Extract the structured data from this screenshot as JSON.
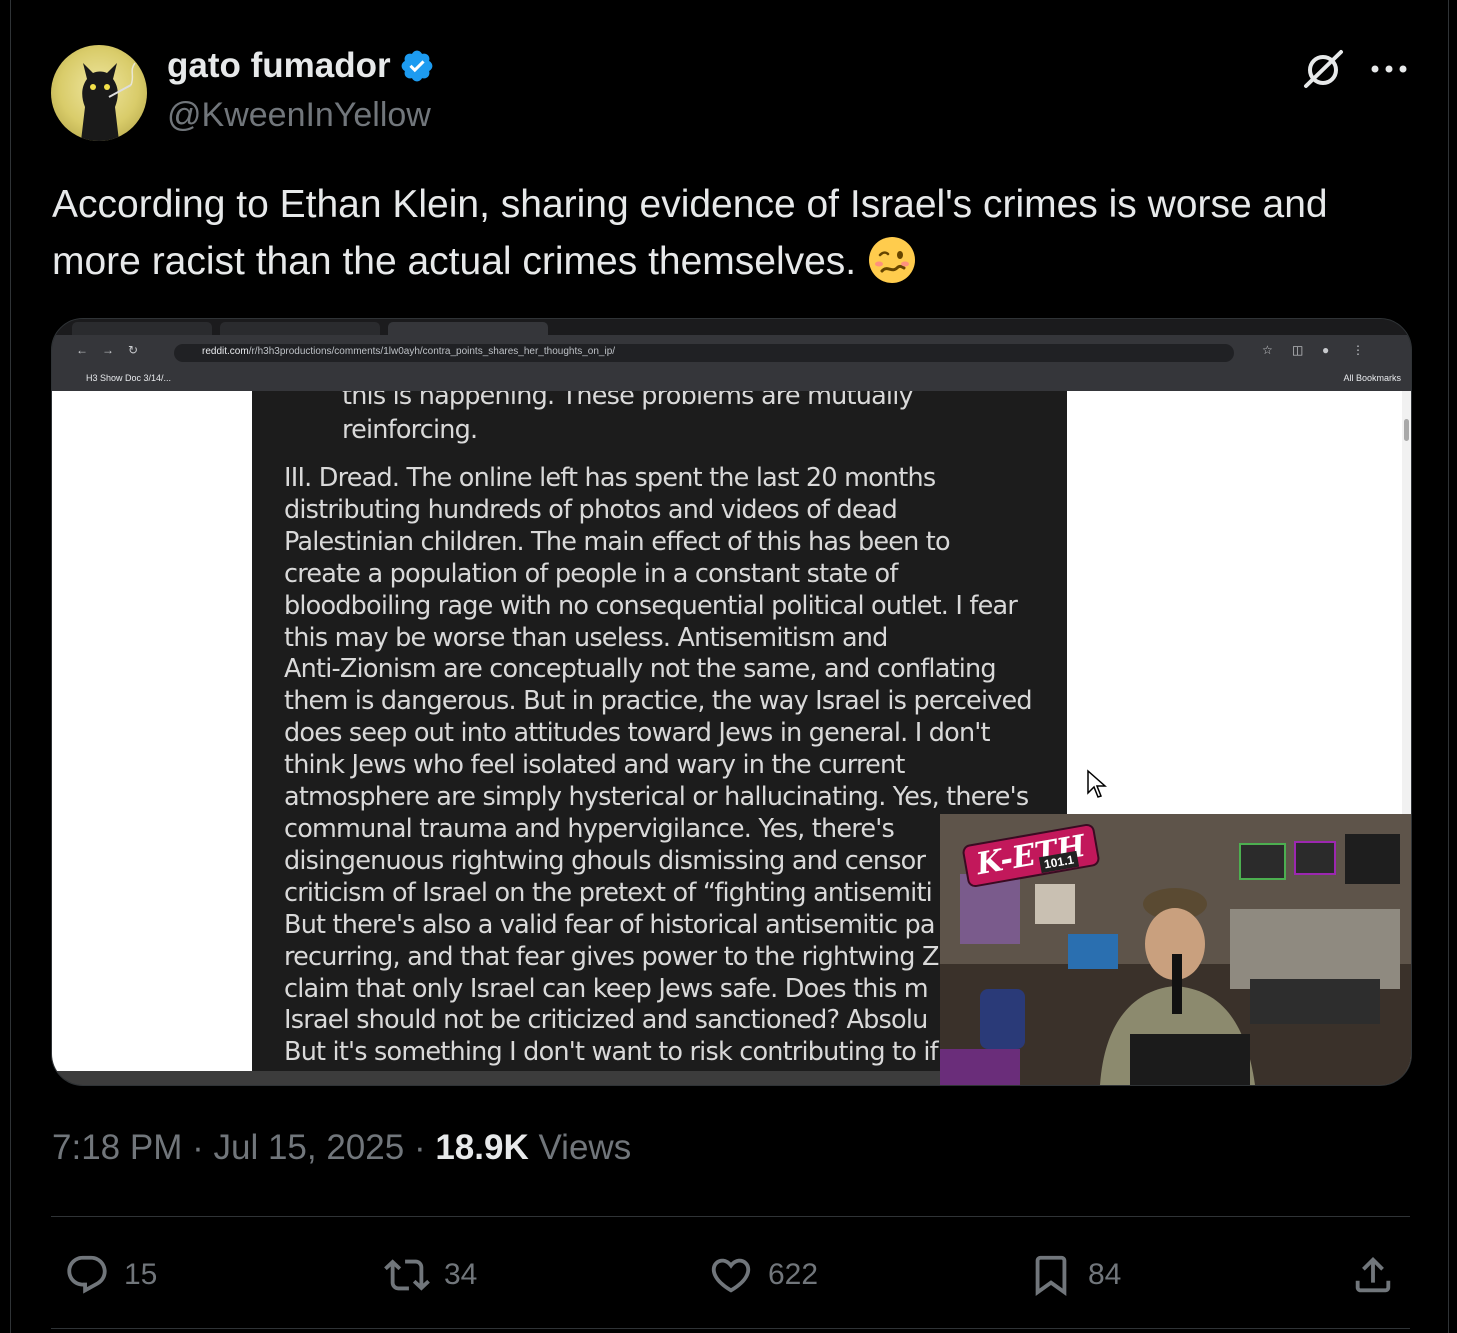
{
  "author": {
    "display_name": "gato fumador",
    "handle": "@KweenInYellow",
    "verified_icon": "verified-badge-icon",
    "accent": "#1d9bf0"
  },
  "tweet": {
    "text": "According to Ethan Klein, sharing evidence of Israel's crimes is worse and more racist than the actual crimes themselves.",
    "emoji": "woozy-face-emoji"
  },
  "media": {
    "browser": {
      "url_host": "reddit.com",
      "url_path": "/r/h3h3productions/comments/1lw0ayh/contra_points_shares_her_thoughts_on_ip/",
      "bookmark": "H3 Show Doc 3/14/...",
      "all_bookmarks": "All Bookmarks"
    },
    "document": {
      "para1": [
        "this is happening. These problems are mutually",
        "reinforcing."
      ],
      "para2": [
        "III. Dread. The online left has spent the last 20 months",
        "distributing hundreds of photos and videos of dead",
        "Palestinian children. The main effect of this has been to",
        "create a population of people in a constant state of",
        "bloodboiling rage with no consequential political outlet. I fear",
        "this may be worse than useless. Antisemitism and",
        "Anti-Zionism are conceptually not the same, and conflating",
        "them is dangerous. But in practice, the way Israel is perceived",
        "does seep out into attitudes toward Jews in general. I don't",
        "think Jews who feel isolated and wary in the current",
        "atmosphere are simply hysterical or hallucinating. Yes, there's",
        "communal trauma and hypervigilance. Yes, there's",
        "disingenuous rightwing ghouls dismissing and censor",
        "criticism of Israel on the pretext of “fighting antisemiti",
        "But there's also a valid fear of historical antisemitic pa",
        "recurring, and that fear gives power to the rightwing Zi",
        "claim that only Israel can keep Jews safe. Does this m",
        "Israel should not be criticized and sanctioned? Absolu",
        "But it's something I don't want to risk contributing to if"
      ]
    },
    "webcam": {
      "logo": "K-ETH",
      "logo_number": "101.1"
    }
  },
  "meta": {
    "time": "7:18 PM",
    "date": "Jul 15, 2025",
    "views_count": "18.9K",
    "views_label": "Views"
  },
  "actions": {
    "replies": "15",
    "reposts": "34",
    "likes": "622",
    "bookmarks": "84"
  },
  "colors": {
    "background": "#000000",
    "text": "#e7e9ea",
    "muted": "#71767b",
    "border": "#2f3336"
  }
}
